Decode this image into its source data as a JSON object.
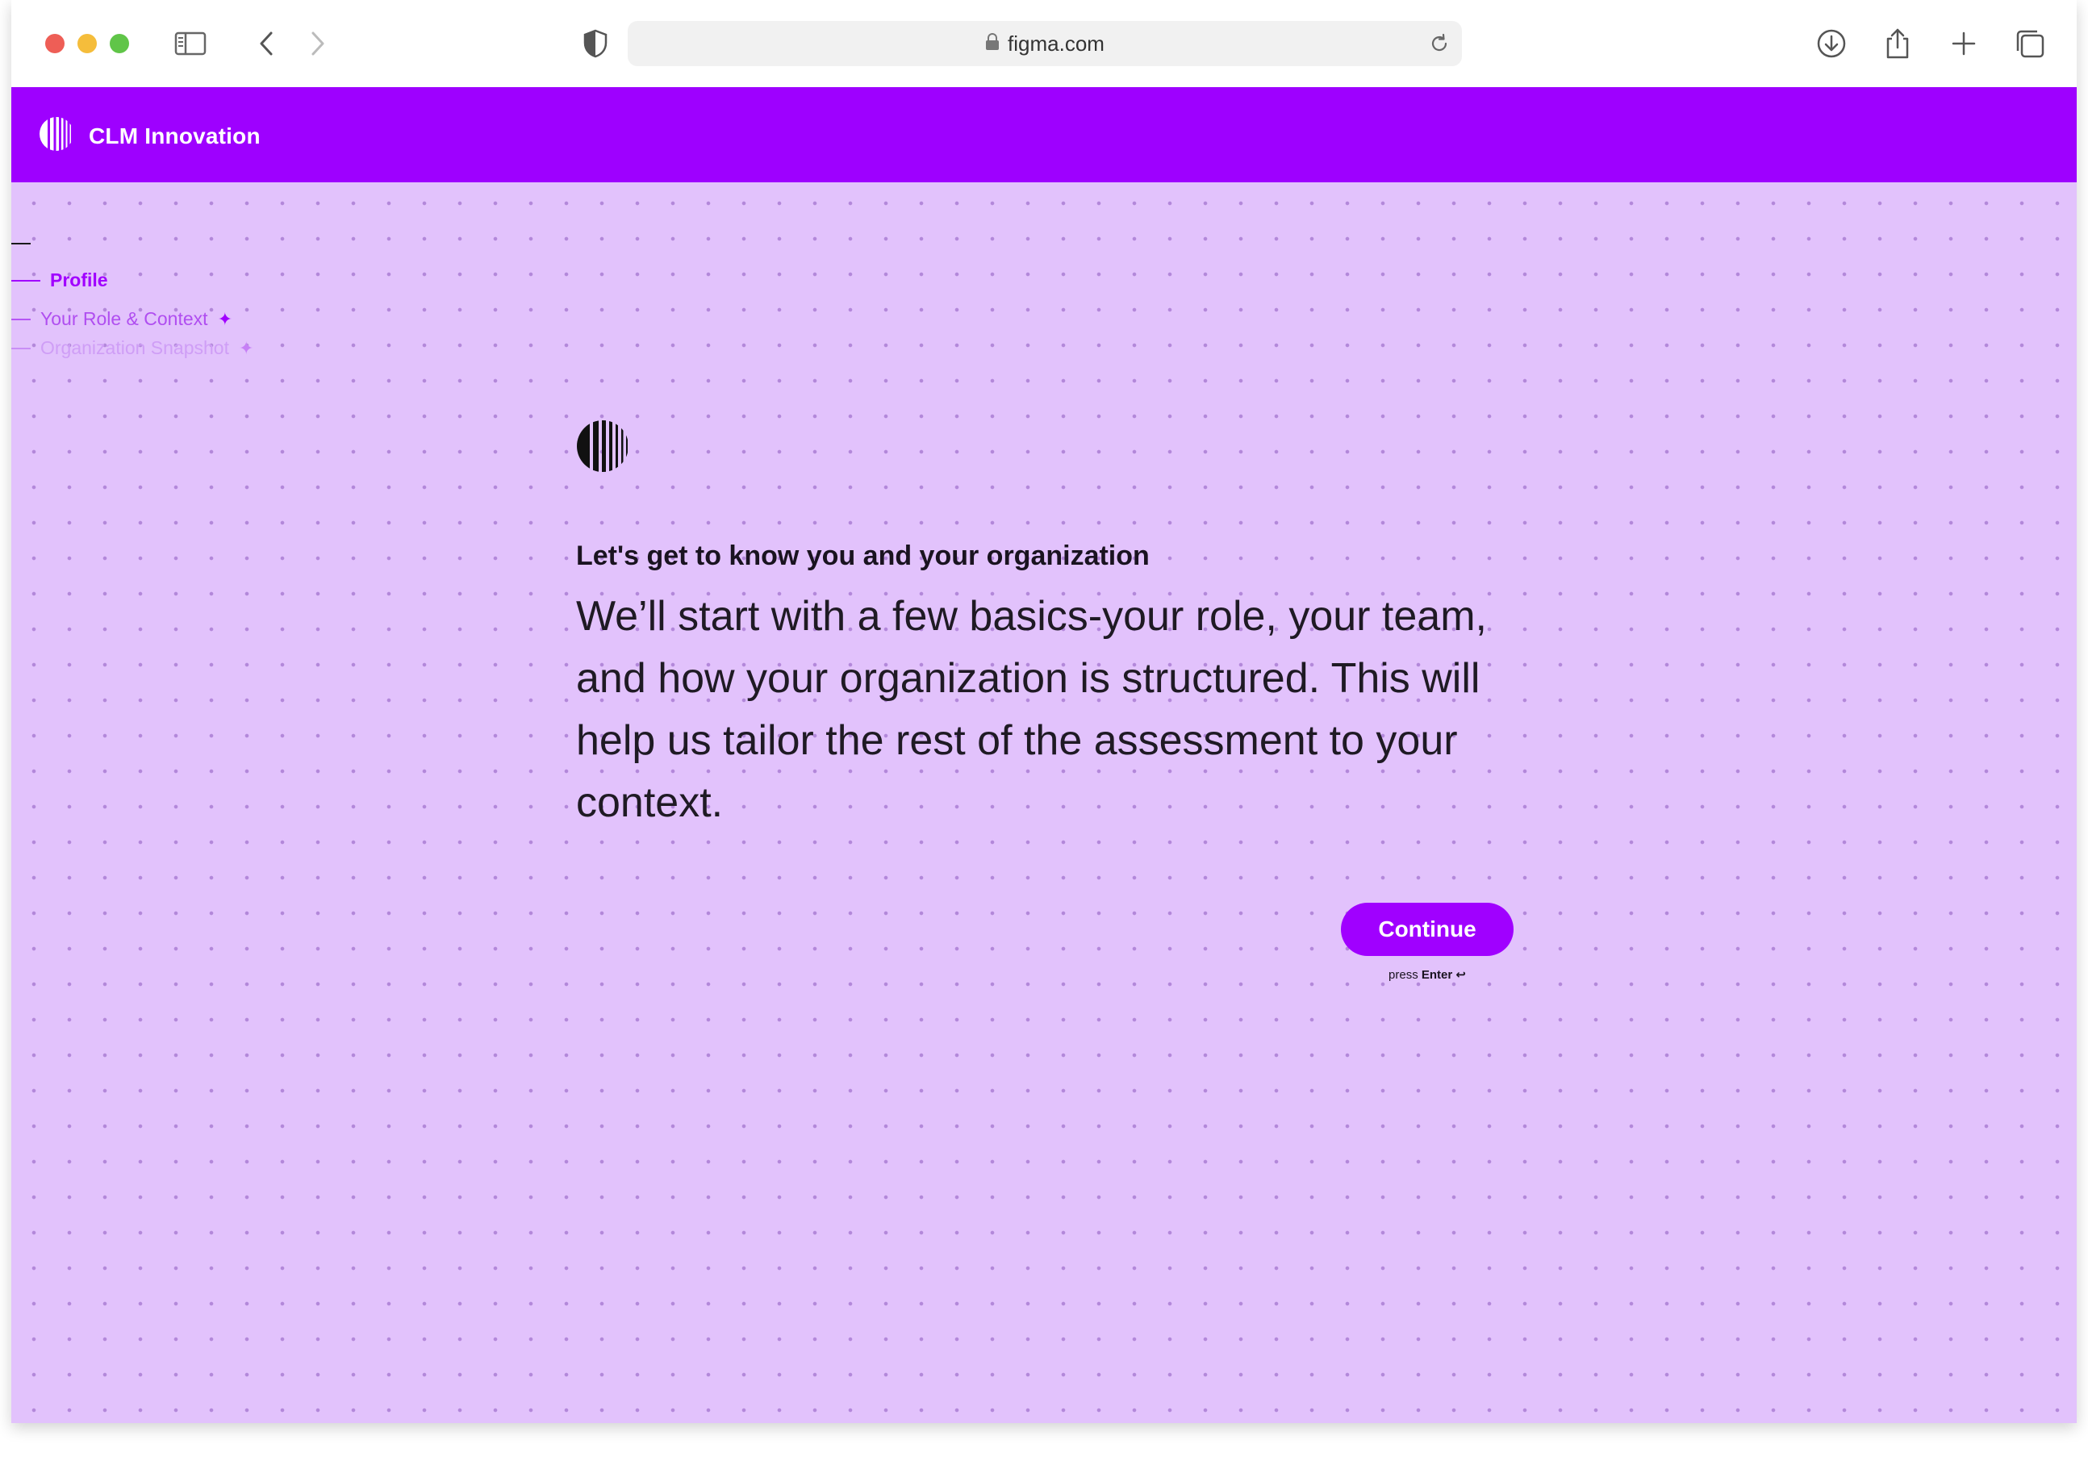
{
  "browser": {
    "url": "figma.com"
  },
  "header": {
    "brand_name": "CLM Innovation"
  },
  "steps": [
    {
      "label": "Profile",
      "state": "active"
    },
    {
      "label": "Your Role & Context",
      "state": "upcoming",
      "marker": "✦"
    },
    {
      "label": "Organization Snapshot",
      "state": "upcoming",
      "marker": "✦"
    }
  ],
  "intro": {
    "eyebrow": "Let's get to know you and your organization",
    "lead": "We’ll start with a few basics-your role, your team, and how your organization is structured. This will help us tailor the rest of the assessment to your context."
  },
  "actions": {
    "continue_label": "Continue",
    "hint_prefix": "press",
    "hint_key": "Enter",
    "hint_key_icon": "↩"
  },
  "colors": {
    "brand_purple": "#9e00ff",
    "content_background": "#e2c2fc",
    "text_dark": "#1f1a24"
  }
}
